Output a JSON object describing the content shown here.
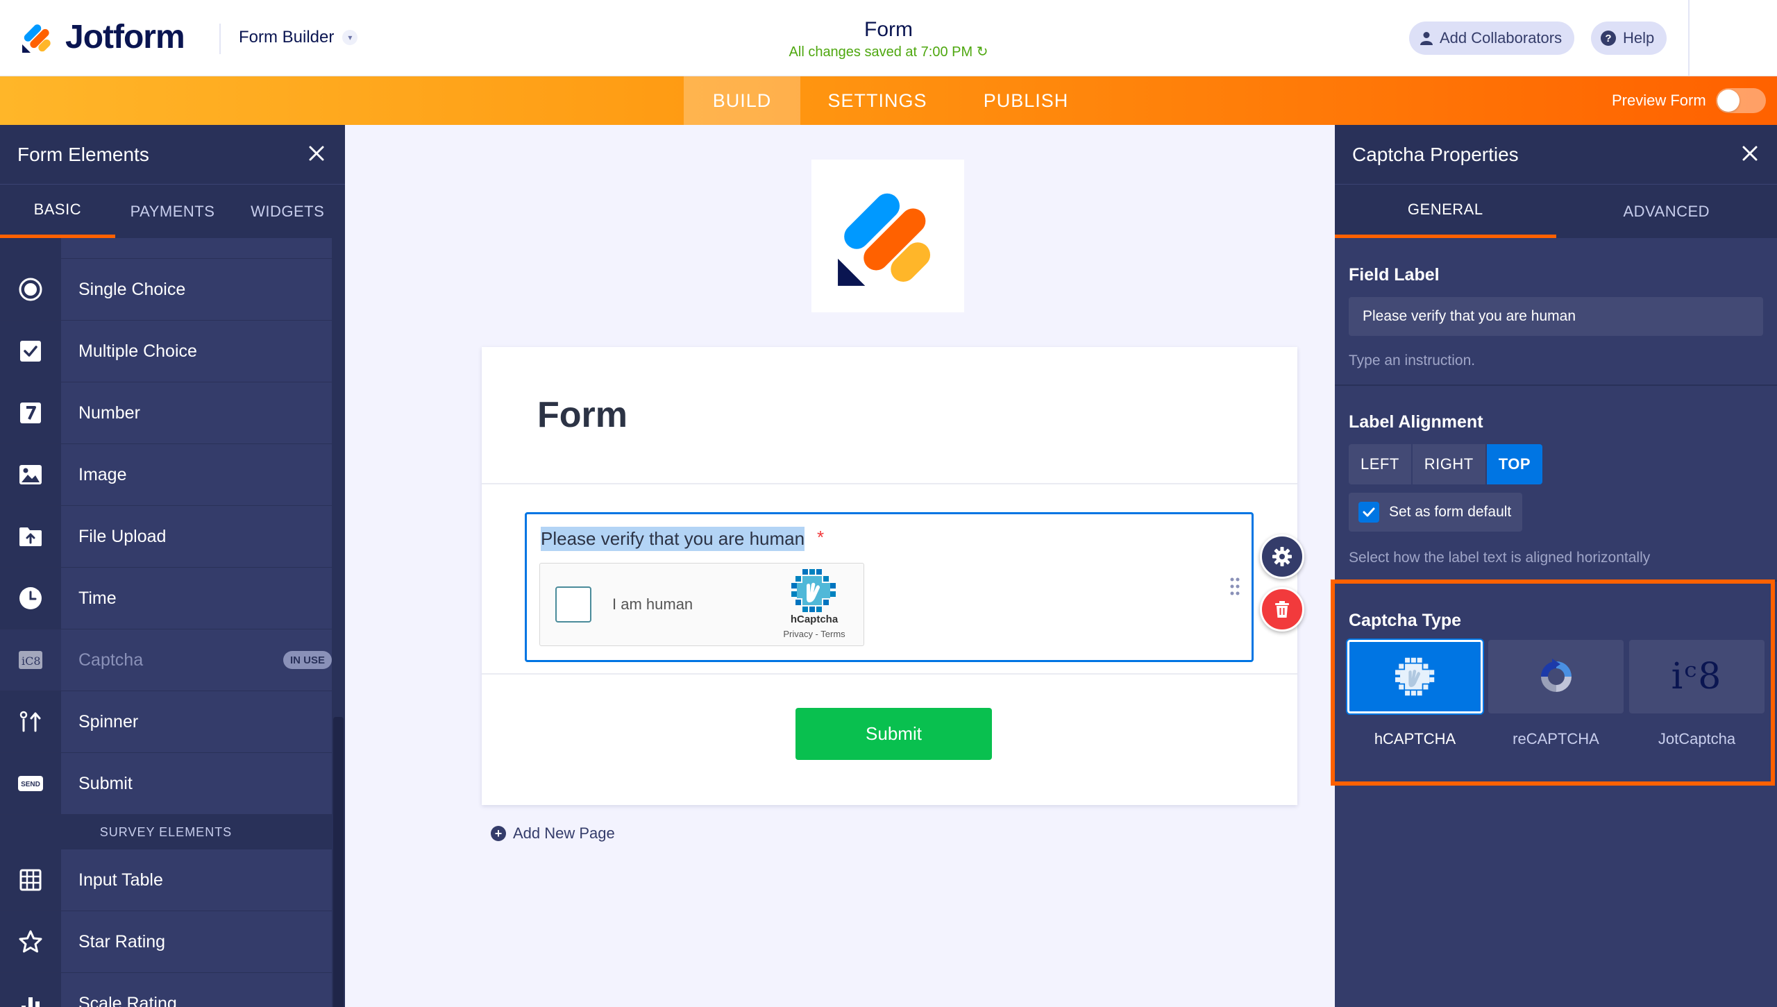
{
  "topbar": {
    "brand": "Jotform",
    "builder_label": "Form Builder",
    "form_title": "Form",
    "saved_status": "All changes saved at 7:00 PM",
    "collaborators_label": "Add Collaborators",
    "help_label": "Help"
  },
  "nav": {
    "tabs": [
      {
        "label": "BUILD",
        "active": true
      },
      {
        "label": "SETTINGS",
        "active": false
      },
      {
        "label": "PUBLISH",
        "active": false
      }
    ],
    "preview_label": "Preview Form"
  },
  "left_panel": {
    "title": "Form Elements",
    "tabs": [
      "BASIC",
      "PAYMENTS",
      "WIDGETS"
    ],
    "items": [
      {
        "label": "Single Choice",
        "icon": "radio-icon"
      },
      {
        "label": "Multiple Choice",
        "icon": "checkbox-icon"
      },
      {
        "label": "Number",
        "icon": "number-icon"
      },
      {
        "label": "Image",
        "icon": "image-icon"
      },
      {
        "label": "File Upload",
        "icon": "file-upload-icon"
      },
      {
        "label": "Time",
        "icon": "clock-icon"
      },
      {
        "label": "Captcha",
        "icon": "captcha-icon",
        "badge": "IN USE"
      },
      {
        "label": "Spinner",
        "icon": "spinner-icon"
      },
      {
        "label": "Submit",
        "icon": "send-icon",
        "icon_text": "SEND"
      }
    ],
    "section_label": "SURVEY ELEMENTS",
    "survey_items": [
      {
        "label": "Input Table",
        "icon": "table-icon"
      },
      {
        "label": "Star Rating",
        "icon": "star-icon"
      },
      {
        "label": "Scale Rating",
        "icon": "bar-chart-icon"
      }
    ]
  },
  "canvas": {
    "form_heading": "Form",
    "captcha_label": "Please verify that you are human",
    "required_mark": "*",
    "hcaptcha_checkbox_text": "I am human",
    "hcaptcha_brand": "hCaptcha",
    "hcaptcha_links": "Privacy - Terms",
    "submit_label": "Submit",
    "add_page_label": "Add New Page"
  },
  "right_panel": {
    "title": "Captcha Properties",
    "tabs": [
      "GENERAL",
      "ADVANCED"
    ],
    "field_label_title": "Field Label",
    "field_label_value": "Please verify that you are human",
    "field_label_hint": "Type an instruction.",
    "label_alignment_title": "Label Alignment",
    "alignment_options": [
      "LEFT",
      "RIGHT",
      "TOP"
    ],
    "alignment_selected": "TOP",
    "set_default_label": "Set as form default",
    "alignment_hint": "Select how the label text is aligned horizontally",
    "captcha_type_title": "Captcha Type",
    "captcha_types": [
      {
        "label": "hCAPTCHA",
        "selected": true
      },
      {
        "label": "reCAPTCHA",
        "selected": false
      },
      {
        "label": "JotCaptcha",
        "selected": false,
        "glyph": "iᶜ8"
      }
    ]
  },
  "colors": {
    "accent_orange": "#ff6100",
    "selection_blue": "#0075e3",
    "panel_dark": "#343c6a",
    "submit_green": "#09c04f",
    "saved_green": "#4ea70f"
  }
}
